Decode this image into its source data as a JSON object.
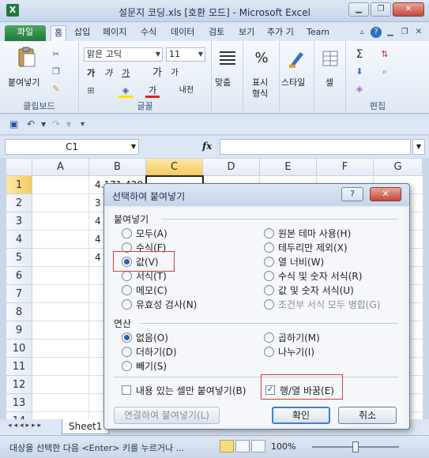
{
  "window": {
    "title": "설문지 코딩.xls  [호환 모드] - Microsoft Excel",
    "app_icon": "X",
    "minimize": "▁",
    "restore": "❐",
    "close": "✕"
  },
  "ribbon_tabs": [
    "파일",
    "홈",
    "삽입",
    "페이지",
    "수식",
    "데이터",
    "검토",
    "보기",
    "추가 기",
    "Team"
  ],
  "ribbon": {
    "clipboard": {
      "label": "클립보드",
      "paste_label": "붙여넣기"
    },
    "font": {
      "label": "글꼴",
      "font_name": "맑은 고딕",
      "font_size": "11",
      "bold": "가",
      "italic": "가",
      "underline": "가",
      "grow": "가",
      "shrink": "가",
      "font_color": "가",
      "phonetic": "내천"
    },
    "alignment_label": "맞춤",
    "number": {
      "label": "표시\n형식",
      "label1": "표시",
      "label2": "형식",
      "symbol": "%"
    },
    "styles_label": "스타일",
    "cells_label": "셀",
    "editing_label": "편집",
    "sigma": "Σ"
  },
  "formula_bar": {
    "name_box": "C1",
    "fx": "fx"
  },
  "grid": {
    "columns": [
      "A",
      "B",
      "C",
      "D",
      "E",
      "F",
      "G"
    ],
    "rows": [
      "1",
      "2",
      "3",
      "4",
      "5",
      "6",
      "7",
      "8",
      "9",
      "10",
      "11",
      "12",
      "13",
      "14"
    ],
    "cells": {
      "B1": "4.171.429",
      "B2": "3",
      "B3": "4",
      "B4": "4",
      "B5": "4"
    }
  },
  "sheet_tab": "Sheet1",
  "sheet_nav": "◂◂◂▸▸▸",
  "status": {
    "message": "대상을 선택한 다음 <Enter> 키를 누르거나 ...",
    "zoom": "100%",
    "zoom_level_percent": 100
  },
  "dialog": {
    "title": "선택하여 붙여넣기",
    "help": "?",
    "close": "✕",
    "paste_section": "붙여넣기",
    "paste_options_left": [
      "모두(A)",
      "수식(F)",
      "값(V)",
      "서식(T)",
      "메모(C)",
      "유효성 검사(N)"
    ],
    "paste_options_right": [
      "원본 테마 사용(H)",
      "테두리만 제외(X)",
      "열 너비(W)",
      "수식 및 숫자 서식(R)",
      "값 및 숫자 서식(U)",
      "조건부 서식 모두 병합(G)"
    ],
    "selected_paste": "값(V)",
    "operation_section": "연산",
    "operation_left": [
      "없음(O)",
      "더하기(D)",
      "빼기(S)"
    ],
    "operation_right": [
      "곱하기(M)",
      "나누기(I)"
    ],
    "selected_operation": "없음(O)",
    "skip_blanks": "내용 있는 셀만 붙여넣기(B)",
    "transpose": "행/열 바꿈(E)",
    "transpose_checked": true,
    "paste_link_button": "연결하여 붙여넣기(L)",
    "ok_button": "확인",
    "cancel_button": "취소"
  }
}
